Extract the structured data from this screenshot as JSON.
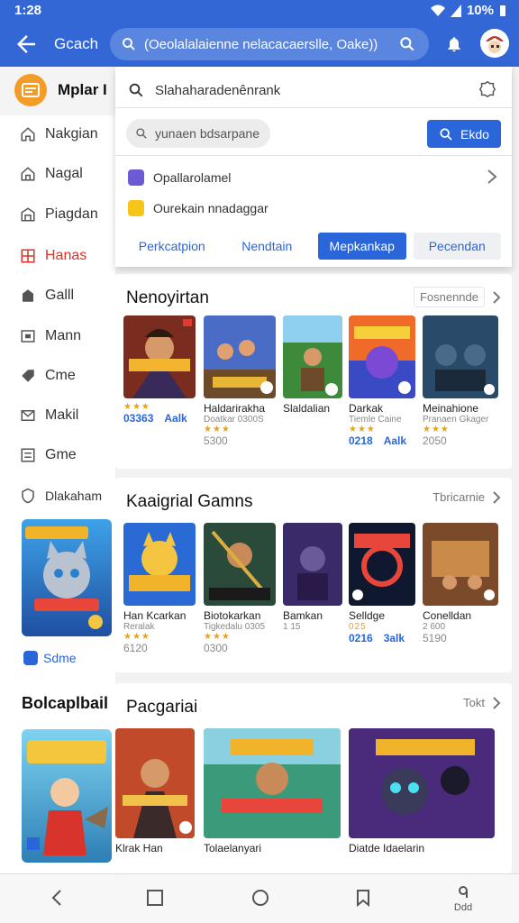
{
  "status": {
    "time": "1:28",
    "battery": "10%"
  },
  "appbar": {
    "title": "Gcach",
    "search_text": "(Oeolalalaienne nelacacaerslle, Oake))"
  },
  "sidebar": {
    "brand": "Mplar I",
    "items": [
      {
        "label": "Nakgian",
        "icon": "home-icon"
      },
      {
        "label": "Nagal",
        "icon": "house-icon"
      },
      {
        "label": "Piagdan",
        "icon": "store-icon"
      },
      {
        "label": "Hanas",
        "icon": "grid-icon"
      },
      {
        "label": "Galll",
        "icon": "game-icon"
      },
      {
        "label": "Mann",
        "icon": "library-icon"
      },
      {
        "label": "Cme",
        "icon": "tag-icon"
      },
      {
        "label": "Makil",
        "icon": "mail-icon"
      },
      {
        "label": "Gme",
        "icon": "list-icon"
      },
      {
        "label": "Dlakaham",
        "icon": "shield-icon"
      }
    ],
    "link_label": "Sdme",
    "section_title": "Bolcaplbail"
  },
  "panel": {
    "query": "Slahaharadenênrank",
    "input_placeholder": "yunaen bdsarpane",
    "search_button": "Ekdo",
    "options": [
      "Opallarolamel",
      "Ourekain nnadaggar"
    ],
    "tabs": [
      "Perkcatpion",
      "Nendtain",
      "Mepkankap",
      "Pecendan"
    ],
    "active_tab": 2
  },
  "sections": [
    {
      "title": "Nenoyirtan",
      "more": "Fosnennde",
      "tiles": [
        {
          "name": "",
          "sub": "",
          "rating": "★★★",
          "price": "03363",
          "price2": "Aalk"
        },
        {
          "name": "Haldarirakha",
          "sub": "Doatkar 0300S",
          "rating": "★★★",
          "price": "",
          "price2": "5300"
        },
        {
          "name": "Slaldalian",
          "sub": "",
          "rating": "",
          "price": "",
          "price2": ""
        },
        {
          "name": "Darkak",
          "sub": "Tiemle Caine",
          "rating": "★★★",
          "price": "0218",
          "price2": "Aalk"
        },
        {
          "name": "Meinahione",
          "sub": "Pranaen Gkager",
          "rating": "★★★",
          "price": "",
          "price2": "2050"
        }
      ]
    },
    {
      "title": "Kaaigrial Gamns",
      "more": "Tbricarnie",
      "tiles": [
        {
          "name": "Han Kcarkan",
          "sub": "Reralak",
          "rating": "★★★",
          "price": "",
          "price2": "6120"
        },
        {
          "name": "Biotokarkan",
          "sub": "Tigkedalu 0305",
          "rating": "★★★",
          "price": "",
          "price2": "0300"
        },
        {
          "name": "Bamkan",
          "sub": "1 15",
          "rating": "",
          "price": "",
          "price2": ""
        },
        {
          "name": "Selldge",
          "sub": "",
          "rating": "025",
          "price": "0216",
          "price2": "3alk"
        },
        {
          "name": "Conelldan",
          "sub": "2 600",
          "rating": "",
          "price": "",
          "price2": "5190"
        }
      ]
    },
    {
      "title": "Pacgariai",
      "more": "Tokt",
      "tiles": [
        {
          "name": "Klrak Han",
          "sub": ""
        },
        {
          "name": "Tolaelanyari",
          "sub": ""
        },
        {
          "name": "Diatde Idaelarin",
          "sub": ""
        }
      ]
    }
  ],
  "bottomnav": {
    "extra": "Ddd"
  },
  "colors": {
    "primary": "#3367d6",
    "accent": "#2a66d9",
    "active_nav": "#d9342b"
  }
}
